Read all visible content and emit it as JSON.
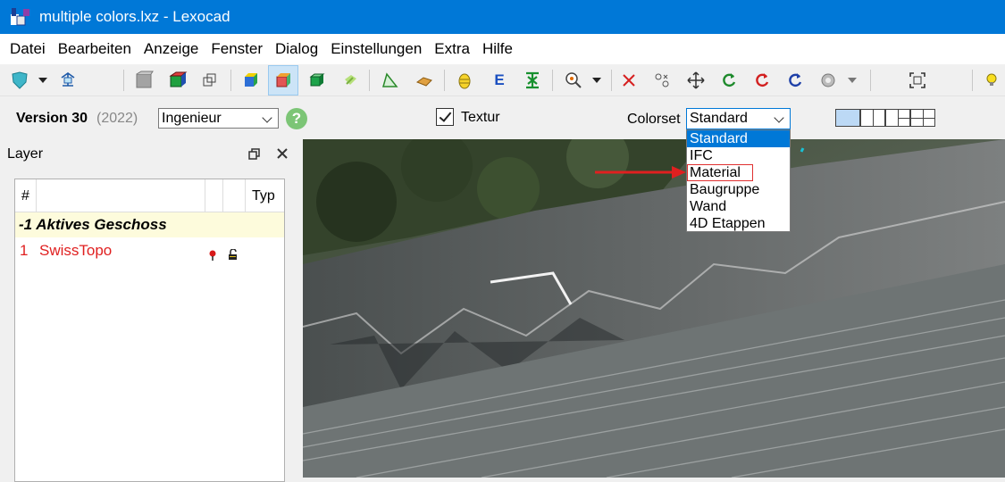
{
  "window": {
    "title": "multiple colors.lxz - Lexocad"
  },
  "menu": [
    "Datei",
    "Bearbeiten",
    "Anzeige",
    "Fenster",
    "Dialog",
    "Einstellungen",
    "Extra",
    "Hilfe"
  ],
  "options": {
    "version": "Version 30",
    "year": "(2022)",
    "mode_value": "Ingenieur",
    "help_glyph": "?",
    "texture_label": "Textur",
    "texture_checked": true,
    "colorset_label": "Colorset",
    "colorset_value": "Standard"
  },
  "colorset_options": [
    "Standard",
    "IFC",
    "Material",
    "Baugruppe",
    "Wand",
    "4D Etappen"
  ],
  "colorset_highlighted": "Standard",
  "colorset_annotated": "Material",
  "layer_panel": {
    "title": "Layer",
    "columns": {
      "num": "#",
      "type": "Typ"
    },
    "active_row": "-1 Aktives Geschoss",
    "rows": [
      {
        "num": "1",
        "name": "SwissTopo"
      }
    ]
  },
  "colors": {
    "titlebar": "#0078d7",
    "annotation_red": "#e02020",
    "layer_red": "#e02020"
  }
}
